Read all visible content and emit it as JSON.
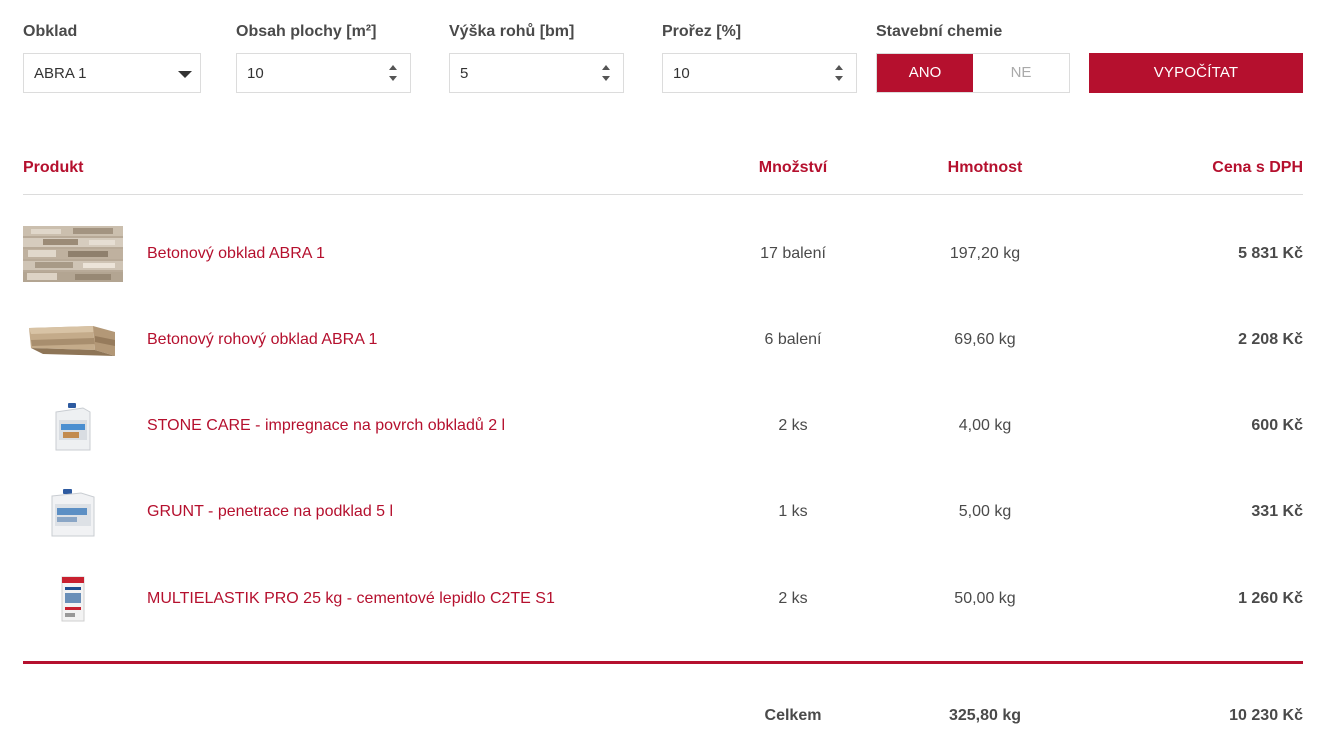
{
  "form": {
    "tile_label": "Obklad",
    "tile_value": "ABRA 1",
    "area_label": "Obsah plochy [m²]",
    "area_value": "10",
    "corner_label": "Výška rohů [bm]",
    "corner_value": "5",
    "waste_label": "Prořez [%]",
    "waste_value": "10",
    "chem_label": "Stavební chemie",
    "chem_yes": "ANO",
    "chem_no": "NE",
    "chem_selected": "ANO",
    "calc_button": "VYPOČÍTAT"
  },
  "table": {
    "headers": {
      "product": "Produkt",
      "quantity": "Množství",
      "weight": "Hmotnost",
      "price": "Cena s DPH"
    },
    "rows": [
      {
        "thumb": "stone-tile-image",
        "name": "Betonový obklad ABRA 1",
        "quantity": "17 balení",
        "weight": "197,20 kg",
        "price": "5 831 Kč"
      },
      {
        "thumb": "corner-tile-image",
        "name": "Betonový rohový obklad ABRA 1",
        "quantity": "6 balení",
        "weight": "69,60 kg",
        "price": "2 208 Kč"
      },
      {
        "thumb": "canister-image",
        "name": "STONE CARE - impregnace na povrch obkladů 2 l",
        "quantity": "2 ks",
        "weight": "4,00 kg",
        "price": "600 Kč"
      },
      {
        "thumb": "canister-image",
        "name": "GRUNT - penetrace na podklad 5 l",
        "quantity": "1 ks",
        "weight": "5,00 kg",
        "price": "331 Kč"
      },
      {
        "thumb": "bag-image",
        "name": "MULTIELASTIK PRO 25 kg - cementové lepidlo C2TE S1",
        "quantity": "2 ks",
        "weight": "50,00 kg",
        "price": "1 260 Kč"
      }
    ],
    "total": {
      "label": "Celkem",
      "weight": "325,80 kg",
      "price": "10 230 Kč"
    }
  },
  "colors": {
    "accent": "#b5102e",
    "text": "#4a4a4a",
    "border": "#dcdcdc"
  }
}
